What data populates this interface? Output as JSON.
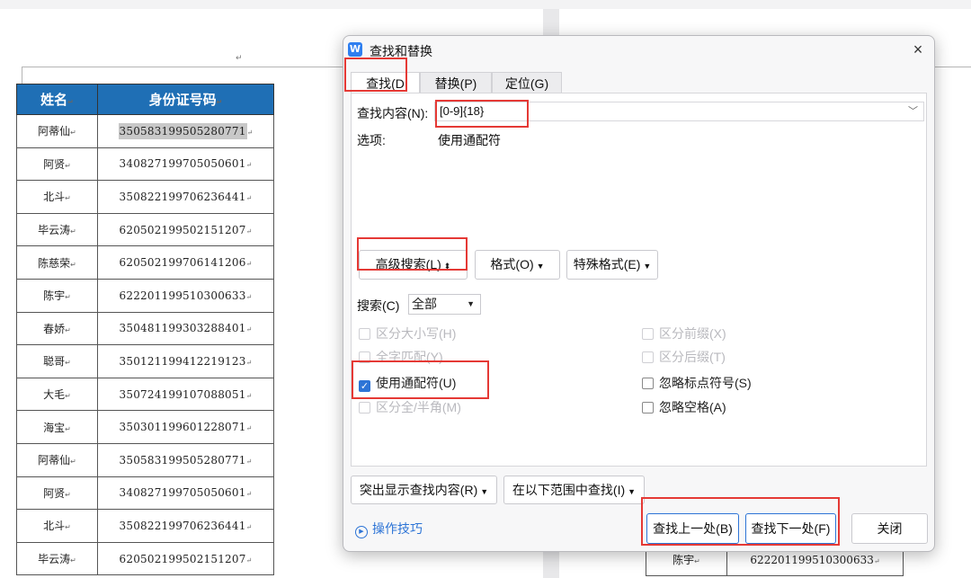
{
  "document": {
    "header_name": "姓名",
    "header_id": "身份证号码",
    "rows": [
      {
        "name": "阿蒂仙",
        "id": "350583199505280771"
      },
      {
        "name": "阿贤",
        "id": "340827199705050601"
      },
      {
        "name": "北斗",
        "id": "350822199706236441"
      },
      {
        "name": "毕云涛",
        "id": "620502199502151207"
      },
      {
        "name": "陈慈荣",
        "id": "620502199706141206"
      },
      {
        "name": "陈宇",
        "id": "622201199510300633"
      },
      {
        "name": "春娇",
        "id": "350481199303288401"
      },
      {
        "name": "聪哥",
        "id": "350121199412219123"
      },
      {
        "name": "大毛",
        "id": "350724199107088051"
      },
      {
        "name": "海宝",
        "id": "350301199601228071"
      },
      {
        "name": "阿蒂仙",
        "id": "350583199505280771"
      },
      {
        "name": "阿贤",
        "id": "340827199705050601"
      },
      {
        "name": "北斗",
        "id": "350822199706236441"
      },
      {
        "name": "毕云涛",
        "id": "620502199502151207"
      }
    ],
    "right_page_row": {
      "name": "陈宇",
      "id": "622201199510300633"
    }
  },
  "dialog": {
    "title": "查找和替换",
    "close_label": "×",
    "tabs": {
      "find": "查找(D",
      "replace": "替换(P)",
      "goto": "定位(G)"
    },
    "find_label": "查找内容(N):",
    "find_value": "[0-9]{18}",
    "options_label": "选项:",
    "options_value": "使用通配符",
    "advanced_button": "高级搜索(L)",
    "format_button": "格式(O)",
    "special_button": "特殊格式(E)",
    "search_label": "搜索(C)",
    "search_value": "全部",
    "options": {
      "match_case": "区分大小写(H)",
      "whole_word": "全字匹配(Y)",
      "wildcards": "使用通配符(U)",
      "full_half": "区分全/半角(M)",
      "prefix": "区分前缀(X)",
      "suffix": "区分后缀(T)",
      "ignore_punct": "忽略标点符号(S)",
      "ignore_space": "忽略空格(A)"
    },
    "highlight_button": "突出显示查找内容(R)",
    "find_in_button": "在以下范围中查找(I)",
    "tips_link": "操作技巧",
    "prev_button": "查找上一处(B)",
    "next_button": "查找下一处(F)",
    "close_button": "关闭"
  },
  "colors": {
    "accent": "#2d74d6",
    "table_header": "#1f6fb5",
    "annotation": "#e53935"
  }
}
